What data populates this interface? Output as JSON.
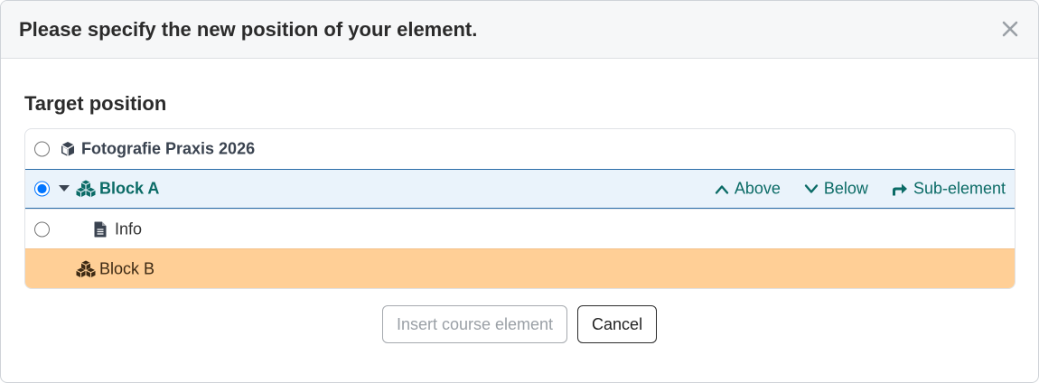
{
  "dialog": {
    "title": "Please specify the new position of your element.",
    "section_title": "Target position"
  },
  "tree": {
    "rows": [
      {
        "label": "Fotografie Praxis 2026",
        "icon": "cube-icon",
        "selected": false
      },
      {
        "label": "Block A",
        "icon": "cubes-icon",
        "selected": true,
        "expanded": true
      },
      {
        "label": "Info",
        "icon": "file-icon",
        "selected": false
      },
      {
        "label": "Block B",
        "icon": "cubes-icon",
        "selected": false,
        "highlighted": true
      }
    ],
    "actions": {
      "above": "Above",
      "below": "Below",
      "sub_element": "Sub-element"
    }
  },
  "buttons": {
    "insert": "Insert course element",
    "cancel": "Cancel"
  },
  "colors": {
    "accent": "#0b6b66",
    "selected_bg": "#eaf3fb",
    "selected_border": "#2a6ca8",
    "highlight_bg": "#ffcf96"
  }
}
